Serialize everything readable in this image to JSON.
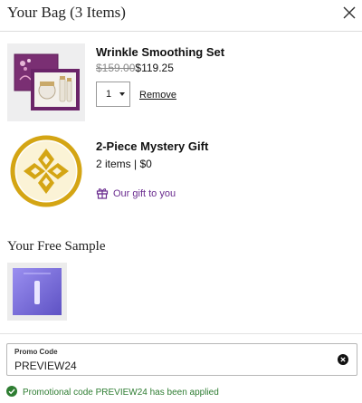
{
  "header": {
    "title": "Your Bag (3 Items)",
    "close_icon": "close-icon"
  },
  "items": [
    {
      "name": "Wrinkle Smoothing Set",
      "price_original": "$159.00",
      "price_sale": "$119.25",
      "quantity": "1",
      "remove_label": "Remove",
      "image_icon": "product-box-image"
    },
    {
      "name": "2-Piece Mystery Gift",
      "detail": "2 items | $0",
      "note": "Our gift to you",
      "note_icon": "gift-icon",
      "image_icon": "gold-medallion-image"
    }
  ],
  "free_sample": {
    "title": "Your Free Sample",
    "image_icon": "sample-packet-image"
  },
  "promo": {
    "label": "Promo Code",
    "value": "PREVIEW24",
    "clear_icon": "clear-circle-icon",
    "status": "Promotional code PREVIEW24 has been applied",
    "status_icon": "check-circle-icon"
  },
  "colors": {
    "accent_purple": "#6a2c8f",
    "success_green": "#2e7d32",
    "divider": "#dcdcdc"
  }
}
